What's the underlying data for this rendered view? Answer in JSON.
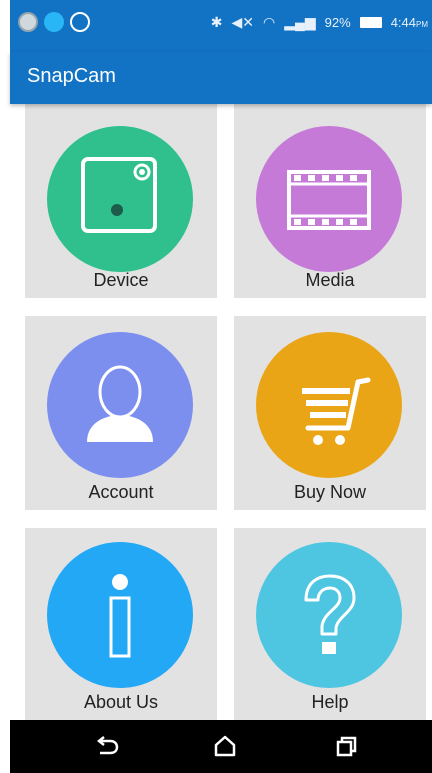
{
  "status_bar": {
    "battery": "92%",
    "time": "4:44",
    "time_suffix": "PM"
  },
  "app_bar": {
    "title": "SnapCam"
  },
  "menu": {
    "device": {
      "label": "Device",
      "color": "#2fc08e",
      "icon": "camera-device-icon"
    },
    "media": {
      "label": "Media",
      "color": "#c57ad8",
      "icon": "film-strip-icon"
    },
    "account": {
      "label": "Account",
      "color": "#7c8fef",
      "icon": "user-silhouette-icon"
    },
    "buy_now": {
      "label": "Buy Now",
      "color": "#e9a516",
      "icon": "shopping-cart-icon"
    },
    "about_us": {
      "label": "About Us",
      "color": "#22a8f5",
      "icon": "info-icon"
    },
    "help": {
      "label": "Help",
      "color": "#4ec6e2",
      "icon": "question-mark-icon"
    }
  },
  "nav_bar": {
    "back_icon": "back-icon",
    "home_icon": "home-icon",
    "recents_icon": "recents-icon"
  }
}
